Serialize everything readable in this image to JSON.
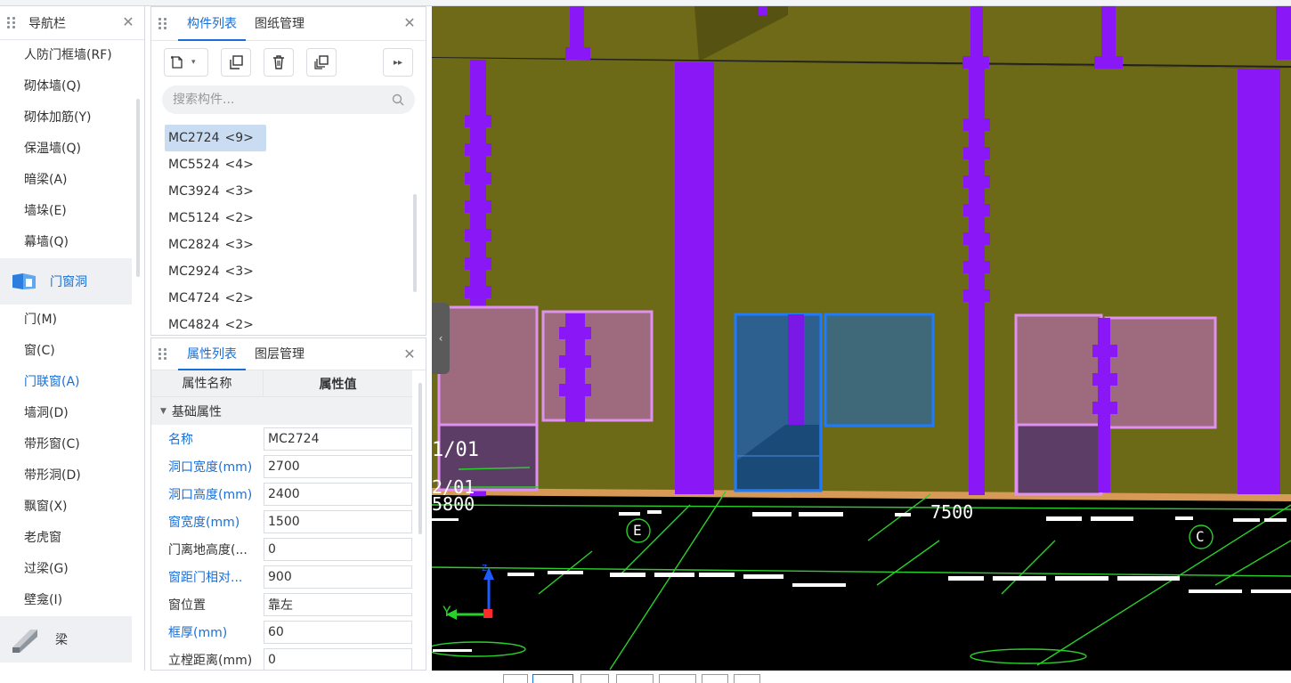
{
  "nav": {
    "title": "导航栏",
    "items_top": [
      "人防门框墙(RF)",
      "砌体墙(Q)",
      "砌体加筋(Y)",
      "保温墙(Q)",
      "暗梁(A)",
      "墙垛(E)",
      "幕墙(Q)"
    ],
    "category_doors": "门窗洞",
    "items_doors": [
      "门(M)",
      "窗(C)",
      "门联窗(A)",
      "墙洞(D)",
      "带形窗(C)",
      "带形洞(D)",
      "飘窗(X)",
      "老虎窗",
      "过梁(G)",
      "壁龛(I)"
    ],
    "category_beam": "梁"
  },
  "components": {
    "tab_active": "构件列表",
    "tab_other": "图纸管理",
    "search_placeholder": "搜索构件...",
    "items": [
      {
        "name": "MC2724",
        "count": "<9>"
      },
      {
        "name": "MC5524",
        "count": "<4>"
      },
      {
        "name": "MC3924",
        "count": "<3>"
      },
      {
        "name": "MC5124",
        "count": "<2>"
      },
      {
        "name": "MC2824",
        "count": "<3>"
      },
      {
        "name": "MC2924",
        "count": "<3>"
      },
      {
        "name": "MC4724",
        "count": "<2>"
      },
      {
        "name": "MC4824",
        "count": "<2>"
      }
    ]
  },
  "properties": {
    "tab_active": "属性列表",
    "tab_other": "图层管理",
    "col_name": "属性名称",
    "col_value": "属性值",
    "group": "基础属性",
    "rows": [
      {
        "name": "名称",
        "value": "MC2724",
        "blue": true
      },
      {
        "name": "洞口宽度(mm)",
        "value": "2700",
        "blue": true
      },
      {
        "name": "洞口高度(mm)",
        "value": "2400",
        "blue": true
      },
      {
        "name": "窗宽度(mm)",
        "value": "1500",
        "blue": true
      },
      {
        "name": "门离地高度(...",
        "value": "0",
        "blue": false
      },
      {
        "name": "窗距门相对...",
        "value": "900",
        "blue": true
      },
      {
        "name": "窗位置",
        "value": "靠左",
        "blue": false
      },
      {
        "name": "框厚(mm)",
        "value": "60",
        "blue": true
      },
      {
        "name": "立樘距离(mm)",
        "value": "0",
        "blue": false
      }
    ]
  },
  "viewport": {
    "dim_5800": "5800",
    "dim_7500": "7500",
    "axis_e": "E",
    "axis_c": "C",
    "label_101": "1/01",
    "label_201": "2/01",
    "axis_y": "Y",
    "axis_z": "Z"
  }
}
